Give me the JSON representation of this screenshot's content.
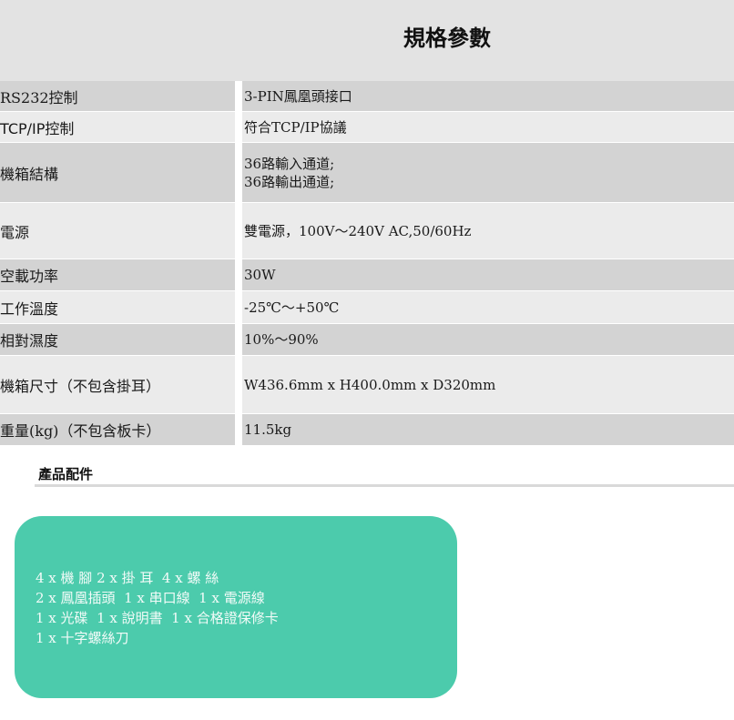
{
  "header": {
    "title": "規格參數"
  },
  "specs": {
    "rows": [
      {
        "label": "RS232控制",
        "values": [
          "3-PIN鳳凰頭接口"
        ]
      },
      {
        "label": "TCP/IP控制",
        "values": [
          "符合TCP/IP協議"
        ]
      },
      {
        "label": "機箱結構",
        "values": [
          "36路輸入通道;",
          "36路輸出通道;"
        ]
      },
      {
        "label": "電源",
        "values": [
          "雙電源，100V～240V AC,50/60Hz"
        ]
      },
      {
        "label": "空載功率",
        "values": [
          "30W"
        ]
      },
      {
        "label": "工作溫度",
        "values": [
          "-25℃～+50℃"
        ]
      },
      {
        "label": "相對濕度",
        "values": [
          "10%～90%"
        ]
      },
      {
        "label": "機箱尺寸（不包含掛耳）",
        "values": [
          "W436.6mm x H400.0mm x D320mm"
        ]
      },
      {
        "label": "重量(kg)（不包含板卡）",
        "values": [
          "11.5kg"
        ]
      }
    ]
  },
  "accessories": {
    "heading": "產品配件",
    "lines": [
      "4 x 機 腳 2 x 掛 耳  4 x 螺 絲",
      "2 x 鳳凰插頭  1 x 串口線  1 x 電源線",
      "1 x 光碟  1 x 說明書  1 x 合格證保修卡",
      "1 x 十字螺絲刀"
    ]
  },
  "colors": {
    "header_bg": "#e3e3e3",
    "row_dark": "#d3d3d3",
    "row_light": "#ebebeb",
    "card_bg": "#4ccbac",
    "card_text": "#f2fbf8"
  }
}
